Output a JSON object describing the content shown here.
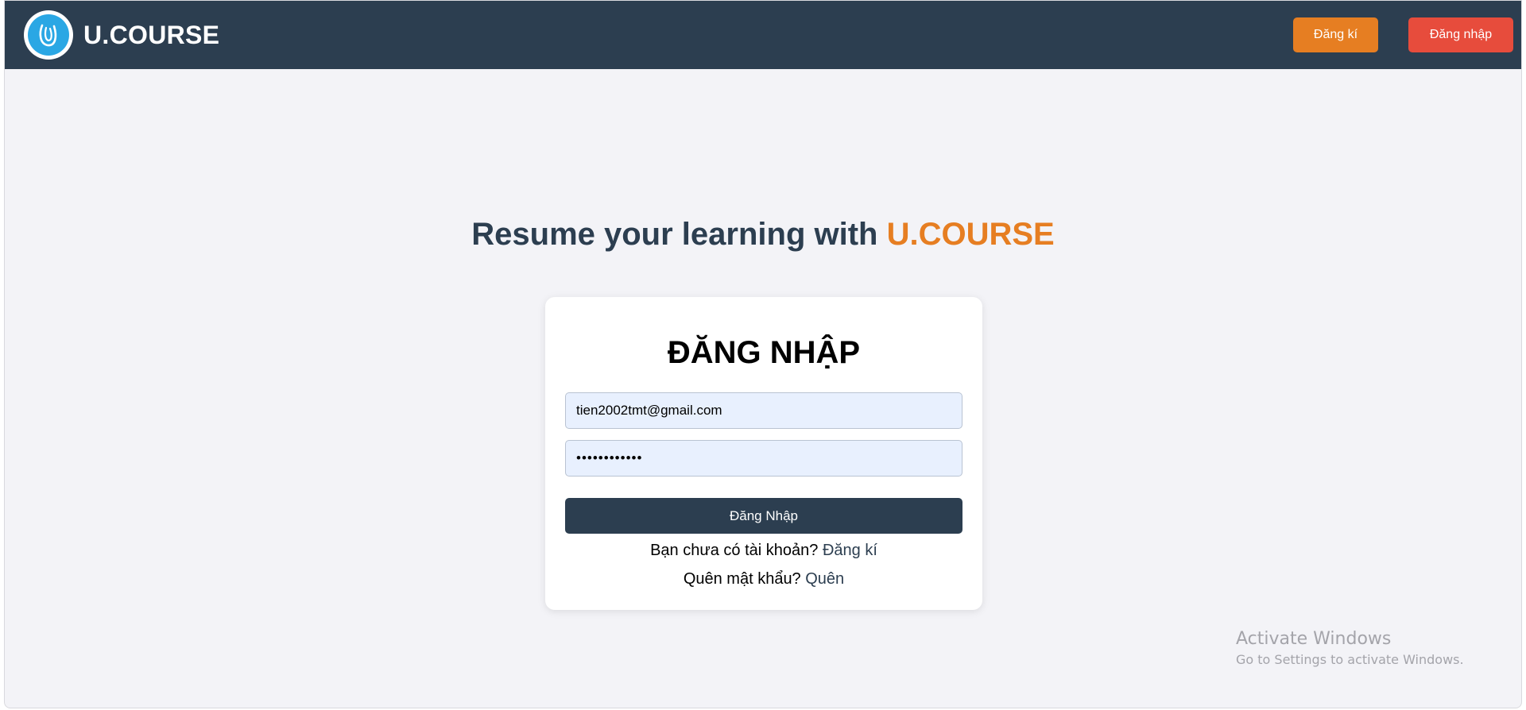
{
  "navbar": {
    "brand": "U.COURSE",
    "register_label": "Đăng kí",
    "login_label": "Đăng nhập"
  },
  "hero": {
    "text": "Resume your learning with ",
    "accent": "U.COURSE"
  },
  "login_form": {
    "title": "ĐĂNG NHẬP",
    "email_value": "tien2002tmt@gmail.com",
    "password_value": "••••••••••••",
    "submit_label": "Đăng Nhập",
    "signup_prompt": "Bạn chưa có tài khoản? ",
    "signup_link": "Đăng kí",
    "forgot_prompt": "Quên mật khẩu? ",
    "forgot_link": "Quên"
  },
  "watermark": {
    "title": "Activate Windows",
    "subtitle": "Go to Settings to activate Windows."
  },
  "colors": {
    "navbar": "#2c3e50",
    "accent_orange": "#e67e22",
    "accent_red": "#e74c3c",
    "page_bg": "#f3f3f7",
    "input_bg": "#e8f0fe"
  },
  "icons": {
    "logo": "u-course-logo-icon"
  }
}
